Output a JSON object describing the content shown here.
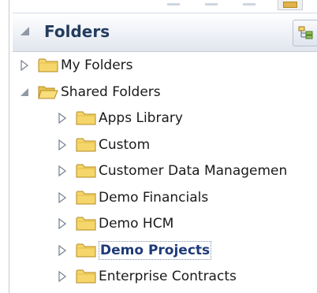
{
  "panel": {
    "title": "Folders"
  },
  "tree": {
    "items": [
      {
        "label": "My Folders",
        "level": 0,
        "expanded": false,
        "selected": false
      },
      {
        "label": "Shared Folders",
        "level": 0,
        "expanded": true,
        "selected": false
      },
      {
        "label": "Apps Library",
        "level": 1,
        "expanded": false,
        "selected": false
      },
      {
        "label": "Custom",
        "level": 1,
        "expanded": false,
        "selected": false
      },
      {
        "label": "Customer Data Managemen",
        "level": 1,
        "expanded": false,
        "selected": false
      },
      {
        "label": "Demo Financials",
        "level": 1,
        "expanded": false,
        "selected": false
      },
      {
        "label": "Demo HCM",
        "level": 1,
        "expanded": false,
        "selected": false
      },
      {
        "label": "Demo Projects",
        "level": 1,
        "expanded": false,
        "selected": true
      },
      {
        "label": "Enterprise Contracts",
        "level": 1,
        "expanded": false,
        "selected": false
      }
    ]
  },
  "icons": {
    "collapse": "collapse-triangle-icon",
    "hierarchy": "hierarchy-view-icon",
    "folder_closed": "folder-icon",
    "folder_open": "folder-open-icon",
    "expand": "expand-triangle-icon"
  },
  "colors": {
    "title": "#223b5e",
    "selected_text": "#1e3b78",
    "folder_fill": "#f5d66b",
    "folder_stroke": "#b48a20"
  }
}
